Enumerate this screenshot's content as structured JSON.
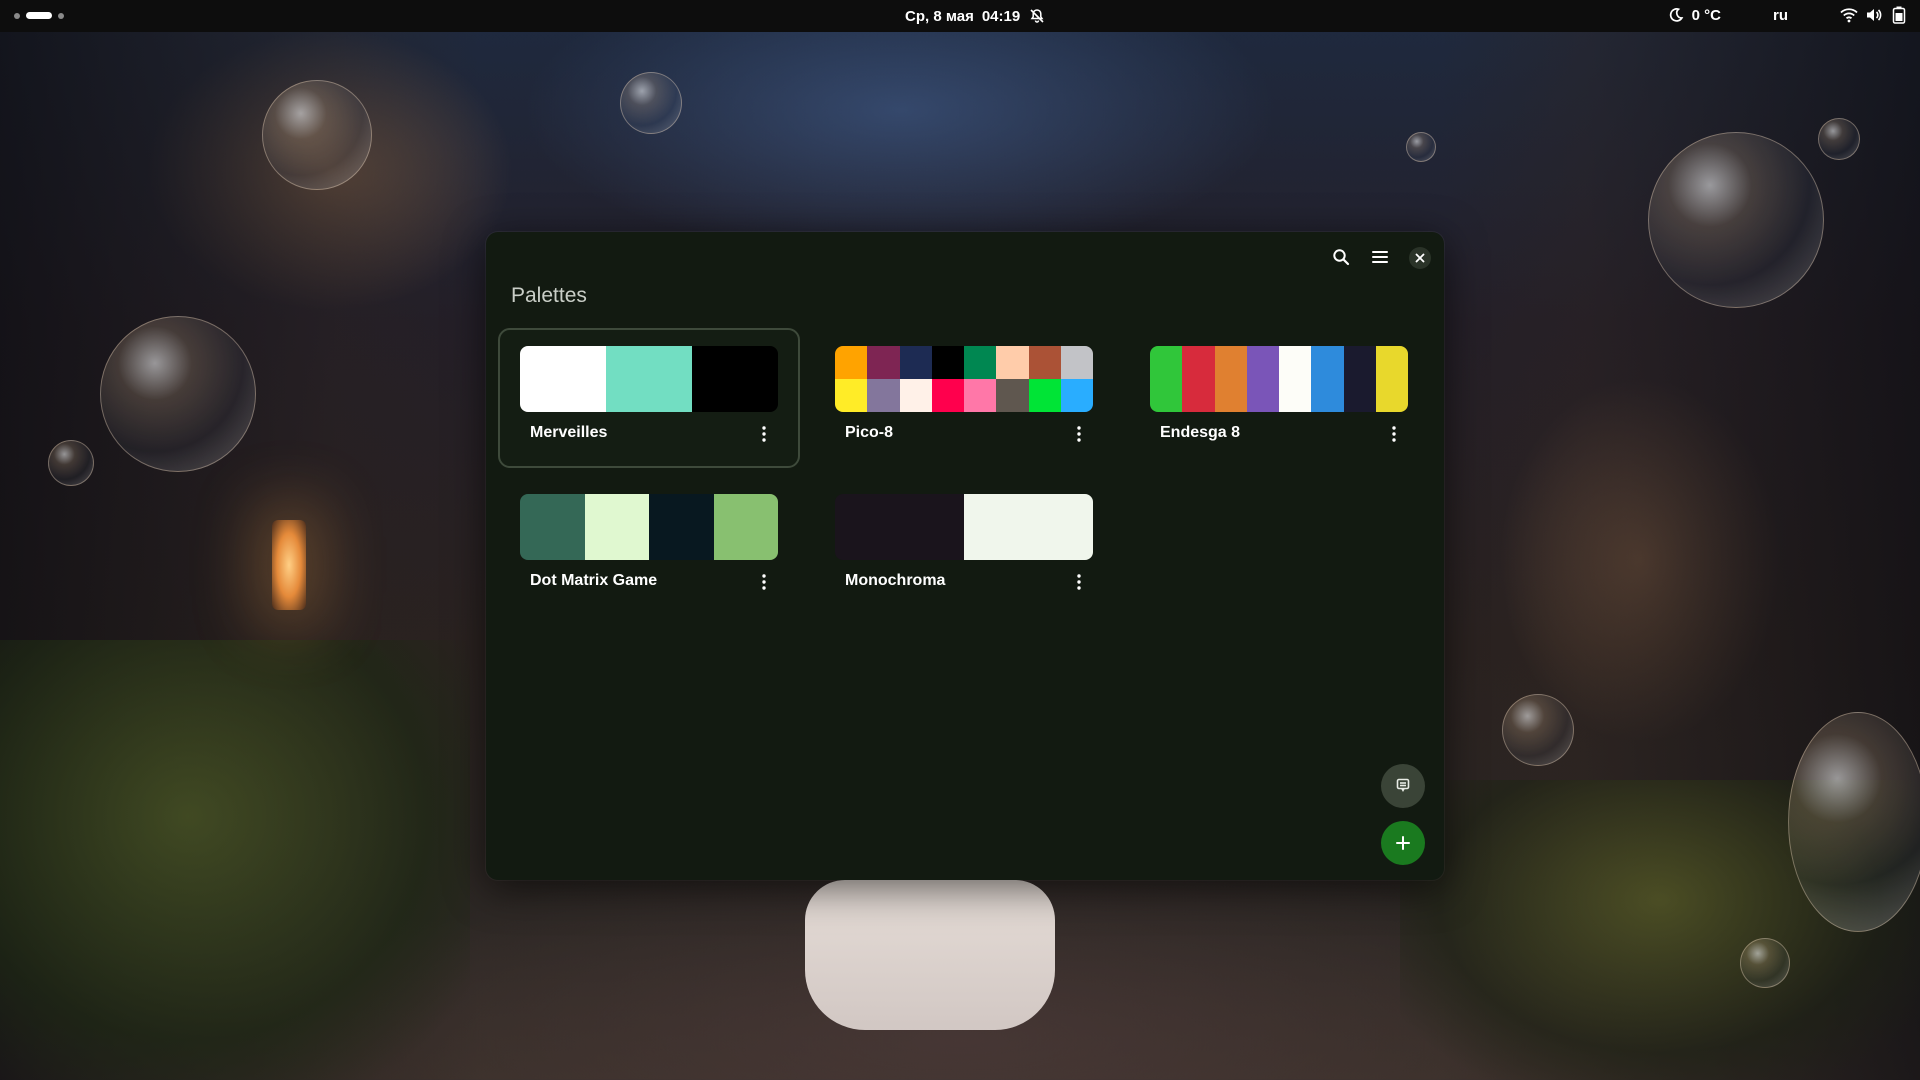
{
  "topbar": {
    "date": "Ср, 8 мая",
    "time": "04:19",
    "temperature": "0 °C",
    "language": "ru",
    "icons": [
      "bell-off-icon",
      "moon-icon",
      "wifi-icon",
      "volume-icon",
      "battery-icon"
    ]
  },
  "window": {
    "title": "Palettes",
    "header_buttons": [
      "search-icon",
      "menu-icon",
      "close-icon"
    ]
  },
  "palettes": [
    {
      "name": "Merveilles",
      "selected": true,
      "rows": 1,
      "colors": [
        "#ffffff",
        "#72dec2",
        "#000000"
      ]
    },
    {
      "name": "Pico-8",
      "selected": false,
      "rows": 2,
      "colors": [
        "#ffa300",
        "#7e2553",
        "#1d2b53",
        "#000000",
        "#008751",
        "#ffccaa",
        "#ab5236",
        "#c2c3c7",
        "#ffec27",
        "#83769c",
        "#fff1e8",
        "#ff004d",
        "#ff77a8",
        "#5f574f",
        "#00e436",
        "#29adff"
      ]
    },
    {
      "name": "Endesga 8",
      "selected": false,
      "rows": 1,
      "colors": [
        "#30c63a",
        "#d72b3c",
        "#e08030",
        "#7a55b8",
        "#fdfdf8",
        "#2e8bdc",
        "#1a1a2e",
        "#e8d82c"
      ]
    },
    {
      "name": "Dot Matrix Game",
      "selected": false,
      "rows": 1,
      "colors": [
        "#346856",
        "#e0f8d0",
        "#081820",
        "#88c070"
      ]
    },
    {
      "name": "Monochroma",
      "selected": false,
      "rows": 1,
      "colors": [
        "#1a141c",
        "#f0f6ec"
      ]
    }
  ],
  "fab": {
    "secondary_icon": "palette-picker-icon",
    "primary_icon": "plus-icon",
    "primary_color": "#1a7a1f"
  }
}
